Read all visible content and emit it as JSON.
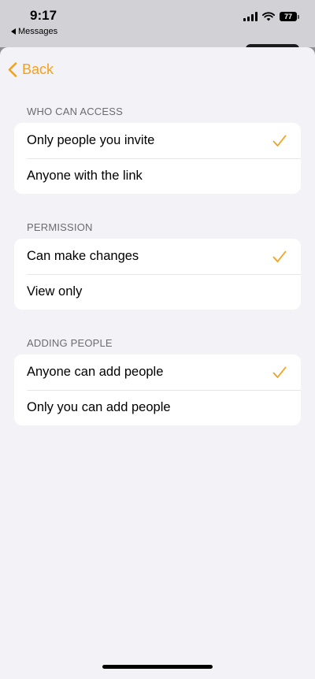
{
  "status_bar": {
    "time": "9:17",
    "back_app": "Messages",
    "battery": "77"
  },
  "nav": {
    "back_label": "Back"
  },
  "colors": {
    "accent": "#f4a11b",
    "background": "#f2f2f7",
    "section_header": "#6c6c70"
  },
  "sections": [
    {
      "header": "WHO CAN ACCESS",
      "options": [
        {
          "label": "Only people you invite",
          "selected": true
        },
        {
          "label": "Anyone with the link",
          "selected": false
        }
      ]
    },
    {
      "header": "PERMISSION",
      "options": [
        {
          "label": "Can make changes",
          "selected": true
        },
        {
          "label": "View only",
          "selected": false
        }
      ]
    },
    {
      "header": "ADDING PEOPLE",
      "options": [
        {
          "label": "Anyone can add people",
          "selected": true
        },
        {
          "label": "Only you can add people",
          "selected": false
        }
      ]
    }
  ]
}
